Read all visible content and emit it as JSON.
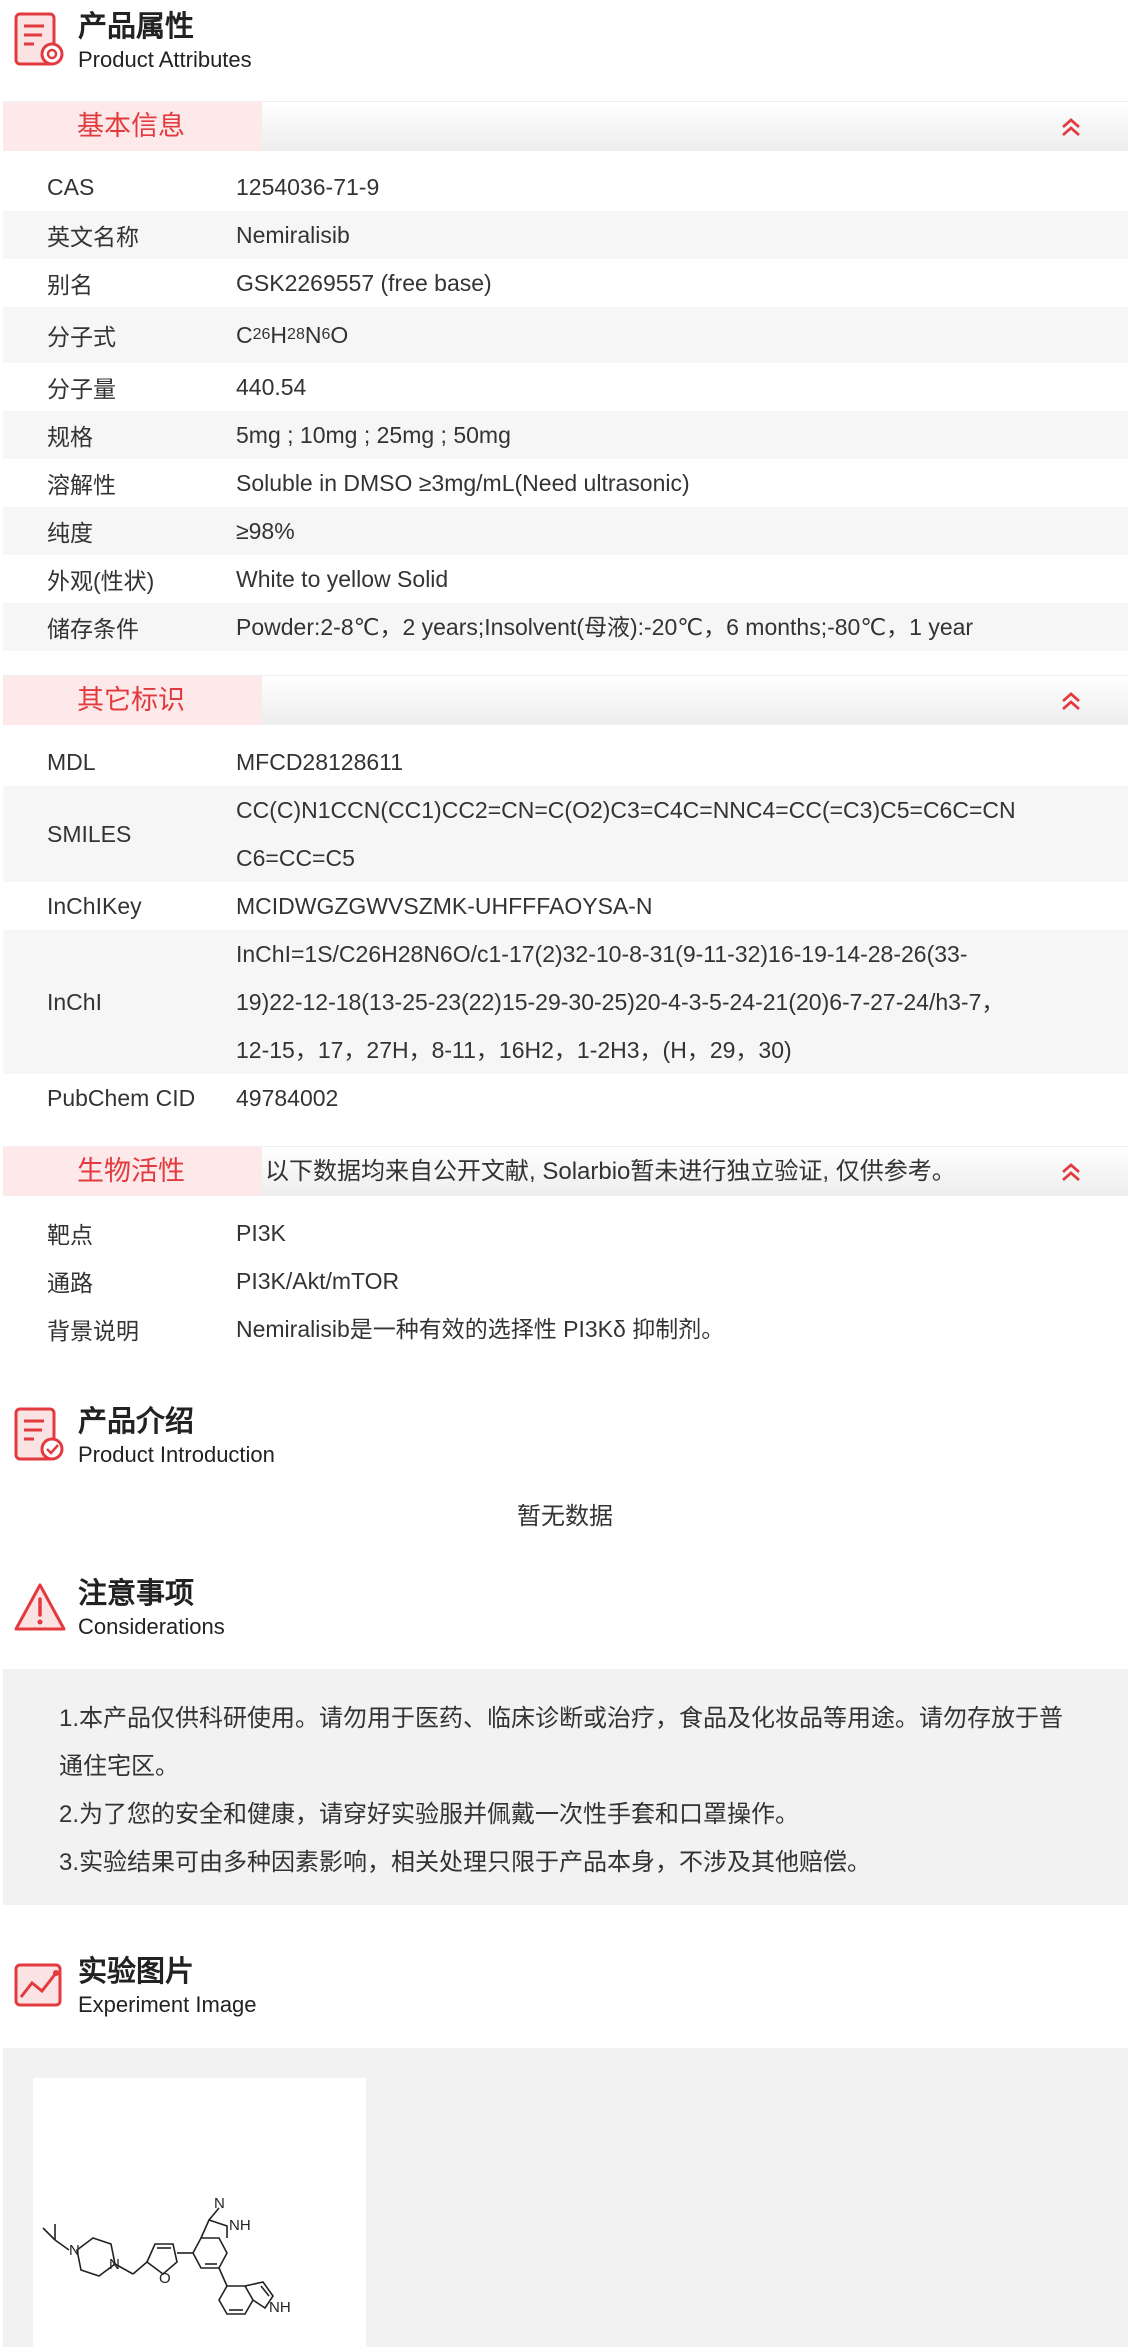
{
  "attributes": {
    "title_zh": "产品属性",
    "title_en": "Product Attributes",
    "icon": "document-gear-icon"
  },
  "basic": {
    "tab": "基本信息",
    "rows": [
      {
        "k": "CAS",
        "v": "1254036-71-9"
      },
      {
        "k": "英文名称",
        "v": "Nemiralisib"
      },
      {
        "k": "别名",
        "v": "GSK2269557 (free base)"
      },
      {
        "k": "分子式",
        "formula": [
          "C",
          "26",
          "H",
          "28",
          "N",
          "6",
          "O"
        ]
      },
      {
        "k": "分子量",
        "v": "440.54"
      },
      {
        "k": "规格",
        "v": "5mg ; 10mg ; 25mg ; 50mg"
      },
      {
        "k": "溶解性",
        "v": "Soluble in DMSO ≥3mg/mL(Need ultrasonic)"
      },
      {
        "k": "纯度",
        "v": "≥98%"
      },
      {
        "k": "外观(性状)",
        "v": "White to yellow Solid"
      },
      {
        "k": "储存条件",
        "v": "Powder:2-8℃，2 years;Insolvent(母液):-20℃，6 months;-80℃，1 year"
      }
    ]
  },
  "other": {
    "tab": "其它标识",
    "mdl_k": "MDL",
    "mdl_v": "MFCD28128611",
    "smiles_k": "SMILES",
    "smiles_1": "CC(C)N1CCN(CC1)CC2=CN=C(O2)C3=C4C=NNC4=CC(=C3)C5=C6C=CN",
    "smiles_2": "C6=CC=C5",
    "inchikey_k": "InChIKey",
    "inchikey_v": "MCIDWGZGWVSZMK-UHFFFAOYSA-N",
    "inchi_k": "InChI",
    "inchi_1": "InChI=1S/C26H28N6O/c1-17(2)32-10-8-31(9-11-32)16-19-14-28-26(33-",
    "inchi_2": "19)22-12-18(13-25-23(22)15-29-30-25)20-4-3-5-24-21(20)6-7-27-24/h3-7，",
    "inchi_3": "12-15，17，27H，8-11，16H2，1-2H3，(H，29，30)",
    "pubchem_k": "PubChem CID",
    "pubchem_v": "49784002"
  },
  "bio": {
    "tab": "生物活性",
    "note": "以下数据均来自公开文献, Solarbio暂未进行独立验证, 仅供参考。",
    "rows": [
      {
        "k": "靶点",
        "v": "PI3K"
      },
      {
        "k": "通路",
        "v": "PI3K/Akt/mTOR"
      },
      {
        "k": "背景说明",
        "v": "Nemiralisib是一种有效的选择性 PI3Kδ 抑制剂。"
      }
    ]
  },
  "intro": {
    "title_zh": "产品介绍",
    "title_en": "Product Introduction",
    "icon": "document-check-icon",
    "empty": "暂无数据"
  },
  "consider": {
    "title_zh": "注意事项",
    "title_en": "Considerations",
    "icon": "warning-icon",
    "line1a": "1.本产品仅供科研使用。请勿用于医药、临床诊断或治疗，食品及化妆品等用途。请勿存放于普",
    "line1b": "通住宅区。",
    "line2": "2.为了您的安全和健康，请穿好实验服并佩戴一次性手套和口罩操作。",
    "line3": "3.实验结果可由多种因素影响，相关处理只限于产品本身，不涉及其他赔偿。"
  },
  "experiment": {
    "title_zh": "实验图片",
    "title_en": "Experiment Image",
    "icon": "chart-image-icon",
    "atoms": {
      "n1": "N",
      "n2": "N",
      "o": "O",
      "n3": "N",
      "nh1": "NH",
      "nh2": "NH"
    }
  },
  "colors": {
    "accent": "#e33a3f",
    "tag_bg": "#fde9e9",
    "stripe": "#f6f6f6"
  }
}
